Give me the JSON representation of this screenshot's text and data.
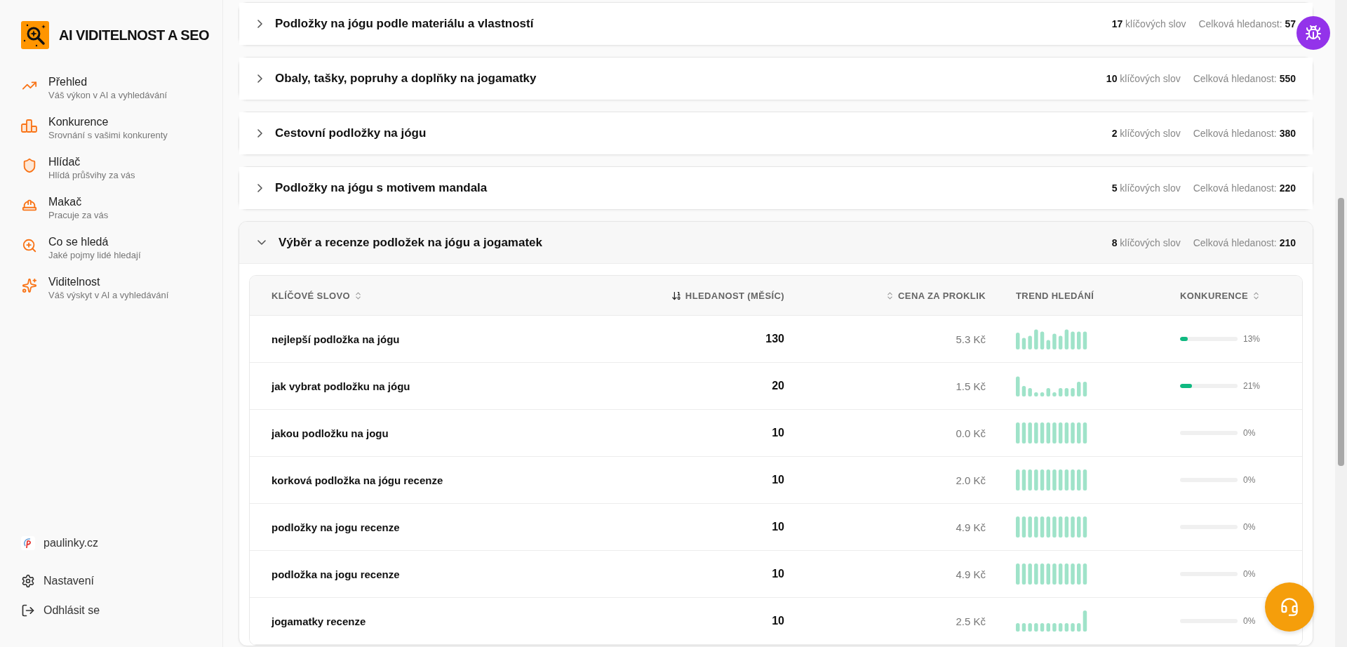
{
  "sidebar": {
    "brand": "AI VIDITELNOST A SEO",
    "items": [
      {
        "kind": "overview",
        "title": "Přehled",
        "subtitle": "Váš výkon v AI a vyhledávání"
      },
      {
        "kind": "competitors",
        "title": "Konkurence",
        "subtitle": "Srovnání s vašimi konkurenty"
      },
      {
        "kind": "guard",
        "title": "Hlídač",
        "subtitle": "Hlídá průšvihy za vás"
      },
      {
        "kind": "worker",
        "title": "Makač",
        "subtitle": "Pracuje za vás"
      },
      {
        "kind": "search",
        "title": "Co se hledá",
        "subtitle": "Jaké pojmy lidé hledají"
      },
      {
        "kind": "visibility",
        "title": "Viditelnost",
        "subtitle": "Váš výskyt v AI a vyhledávání"
      }
    ],
    "site": "paulinky.cz",
    "footer": [
      {
        "kind": "settings",
        "label": "Nastavení"
      },
      {
        "kind": "logout",
        "label": "Odhlásit se"
      }
    ]
  },
  "groups": [
    {
      "title": "Podložky na jógu podle materiálu a vlastností",
      "count": "17",
      "count_label": "klíčových slov",
      "total_label": "Celková hledanost:",
      "total": "57",
      "expanded": false
    },
    {
      "title": "Obaly, tašky, popruhy a doplňky na jogamatky",
      "count": "10",
      "count_label": "klíčových slov",
      "total_label": "Celková hledanost:",
      "total": "550",
      "expanded": false
    },
    {
      "title": "Cestovní podložky na jógu",
      "count": "2",
      "count_label": "klíčových slov",
      "total_label": "Celková hledanost:",
      "total": "380",
      "expanded": false
    },
    {
      "title": "Podložky na jógu s motivem mandala",
      "count": "5",
      "count_label": "klíčových slov",
      "total_label": "Celková hledanost:",
      "total": "220",
      "expanded": false
    },
    {
      "title": "Výběr a recenze podložek na jógu a jogamatek",
      "count": "8",
      "count_label": "klíčových slov",
      "total_label": "Celková hledanost:",
      "total": "210",
      "expanded": true
    }
  ],
  "table": {
    "columns": [
      {
        "label": "KLÍČOVÉ SLOVO",
        "kind": "sortable"
      },
      {
        "label": "HLEDANOST (MĚSÍC)",
        "kind": "sorted"
      },
      {
        "label": "CENA ZA PROKLIK",
        "kind": "sortable"
      },
      {
        "label": "TREND HLEDÁNÍ",
        "kind": "plain"
      },
      {
        "label": "KONKURENCE",
        "kind": "sortable"
      }
    ],
    "rows": [
      {
        "keyword": "nejlepší podložka na jógu",
        "volume": "130",
        "cpc": "5.3 Kč",
        "competition": "13%",
        "level": 0.13
      },
      {
        "keyword": "jak vybrat podložku na jógu",
        "volume": "20",
        "cpc": "1.5 Kč",
        "competition": "21%",
        "level": 0.21
      },
      {
        "keyword": "jakou podložku na jogu",
        "volume": "10",
        "cpc": "0.0 Kč",
        "competition": "0%",
        "level": 0
      },
      {
        "keyword": "korková podložka na jógu recenze",
        "volume": "10",
        "cpc": "2.0 Kč",
        "competition": "0%",
        "level": 0
      },
      {
        "keyword": "podložky na jogu recenze",
        "volume": "10",
        "cpc": "4.9 Kč",
        "competition": "0%",
        "level": 0
      },
      {
        "keyword": "podložka na jogu recenze",
        "volume": "10",
        "cpc": "4.9 Kč",
        "competition": "0%",
        "level": 0
      },
      {
        "keyword": "jogamatky recenze",
        "volume": "10",
        "cpc": "2.5 Kč",
        "competition": "0%",
        "level": 0
      }
    ]
  }
}
